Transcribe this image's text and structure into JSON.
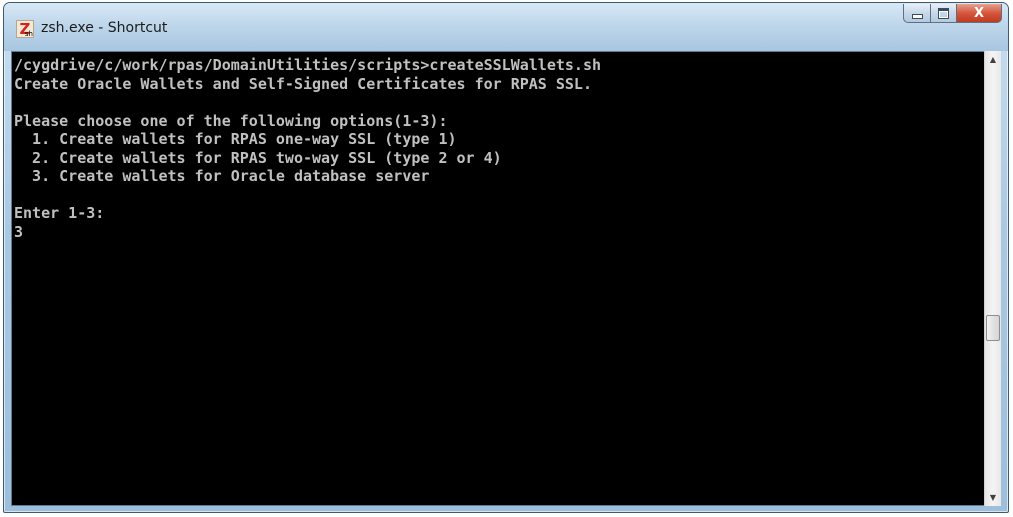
{
  "window": {
    "title": "zsh.exe - Shortcut",
    "icon": "zsh-icon",
    "icon_letter": "Z",
    "icon_sub": "sh",
    "close_glyph": "X"
  },
  "console": {
    "lines": [
      "/cygdrive/c/work/rpas/DomainUtilities/scripts>createSSLWallets.sh",
      "Create Oracle Wallets and Self-Signed Certificates for RPAS SSL.",
      "",
      "Please choose one of the following options(1-3):",
      "  1. Create wallets for RPAS one-way SSL (type 1)",
      "  2. Create wallets for RPAS two-way SSL (type 2 or 4)",
      "  3. Create wallets for Oracle database server",
      "",
      "Enter 1-3:",
      "3"
    ],
    "background_color": "#000000",
    "text_color": "#c0c0c0"
  },
  "scrollbar": {
    "up_glyph": "▲",
    "down_glyph": "▼"
  }
}
